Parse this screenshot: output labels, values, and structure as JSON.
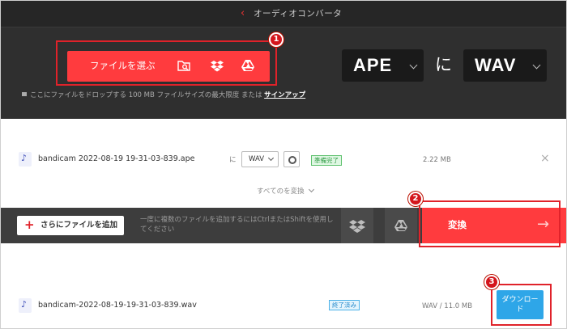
{
  "header": {
    "back_glyph": "‹",
    "title": "オーディオコンバータ"
  },
  "upload": {
    "choose_label": "ファイルを選ぶ",
    "icons": [
      "folder-search-icon",
      "dropbox-icon",
      "google-drive-icon"
    ],
    "drop_text": "ここにファイルをドロップする 100 MB ファイルサイズの最大限度 または",
    "signup_link": "サインアップ"
  },
  "format_selector": {
    "from": "APE",
    "connector": "に",
    "to": "WAV"
  },
  "annotations": [
    "1",
    "2",
    "3"
  ],
  "file_rows": [
    {
      "name": "bandicam 2022-08-19 19-31-03-839.ape",
      "to_label": "に",
      "format": "WAV",
      "status": "準備完了",
      "size": "2.22 MB",
      "close_glyph": "×"
    },
    {
      "name": "bandicam-2022-08-19-19-31-03-839.wav",
      "status": "終了済み",
      "size": "WAV / 11.0 MB",
      "download_label": "ダウンロード"
    }
  ],
  "convert_all": "すべてのを変換",
  "action_bar": {
    "add_label": "さらにファイルを追加",
    "hint": "一度に複数のファイルを追加するにはCtrlまたはShiftを使用してください",
    "convert_label": "変換",
    "arrow_glyph": "→"
  },
  "colors": {
    "brand_red": "#ff3b3e",
    "annotation_red": "#e0222a",
    "dark_bg": "#2f2f2f",
    "download_blue": "#2ea6e8",
    "ready_green": "#2f9b44"
  }
}
